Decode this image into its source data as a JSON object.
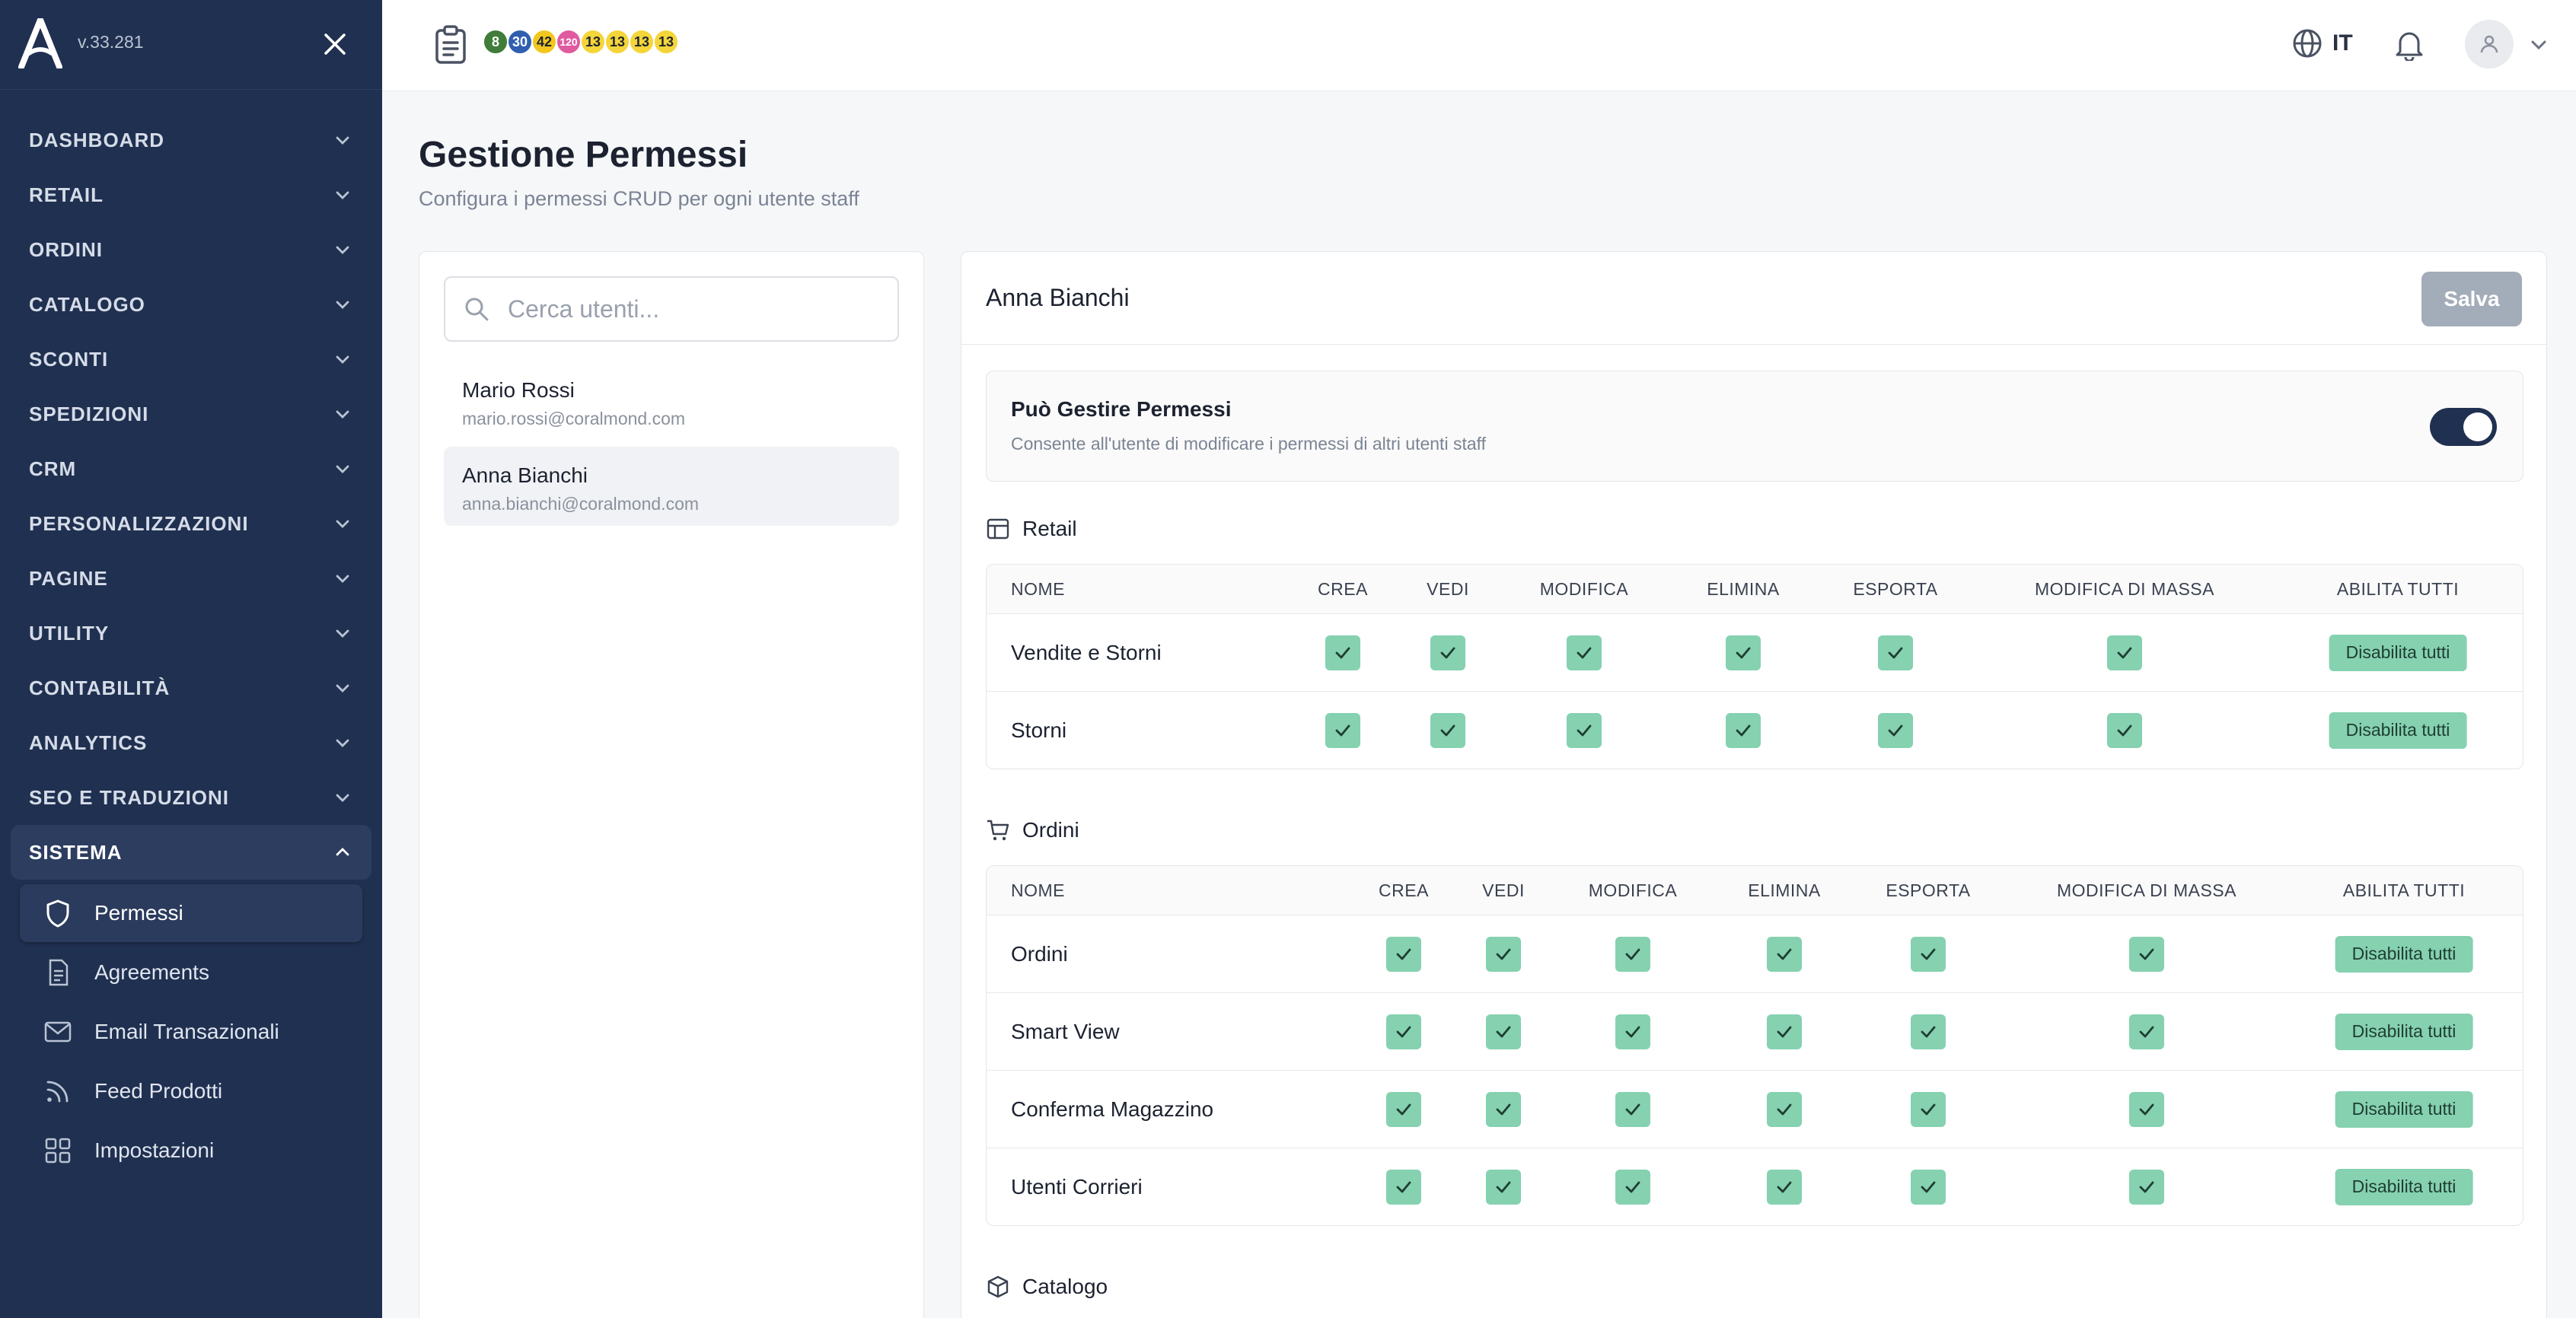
{
  "app": {
    "version": "v.33.281"
  },
  "sidebar": {
    "items": [
      {
        "label": "DASHBOARD"
      },
      {
        "label": "RETAIL"
      },
      {
        "label": "ORDINI"
      },
      {
        "label": "CATALOGO"
      },
      {
        "label": "SCONTI"
      },
      {
        "label": "SPEDIZIONI"
      },
      {
        "label": "CRM"
      },
      {
        "label": "PERSONALIZZAZIONI"
      },
      {
        "label": "PAGINE"
      },
      {
        "label": "UTILITY"
      },
      {
        "label": "CONTABILITÀ"
      },
      {
        "label": "ANALYTICS"
      },
      {
        "label": "SEO E TRADUZIONI"
      },
      {
        "label": "SISTEMA"
      }
    ],
    "active_index": 13,
    "subitems": [
      {
        "label": "Permessi",
        "icon": "shield-icon",
        "active": true
      },
      {
        "label": "Agreements",
        "icon": "document-icon",
        "active": false
      },
      {
        "label": "Email Transazionali",
        "icon": "mail-icon",
        "active": false
      },
      {
        "label": "Feed Prodotti",
        "icon": "rss-icon",
        "active": false
      },
      {
        "label": "Impostazioni",
        "icon": "grid-icon",
        "active": false
      }
    ]
  },
  "topbar": {
    "badges": [
      {
        "value": "8",
        "bg": "#3f7d3a",
        "fg": "#ffffff"
      },
      {
        "value": "30",
        "bg": "#2f5fae",
        "fg": "#ffffff"
      },
      {
        "value": "42",
        "bg": "#f1c71d",
        "fg": "#1f2430"
      },
      {
        "value": "120",
        "bg": "#e05aa0",
        "fg": "#ffffff"
      },
      {
        "value": "13",
        "bg": "#f4d53a",
        "fg": "#1f2430"
      },
      {
        "value": "13",
        "bg": "#f4d53a",
        "fg": "#1f2430"
      },
      {
        "value": "13",
        "bg": "#f4d53a",
        "fg": "#1f2430"
      },
      {
        "value": "13",
        "bg": "#f4d53a",
        "fg": "#1f2430"
      }
    ],
    "language": "IT"
  },
  "page": {
    "title": "Gestione Permessi",
    "subtitle": "Configura i permessi CRUD per ogni utente staff"
  },
  "users": {
    "search_placeholder": "Cerca utenti...",
    "list": [
      {
        "name": "Mario Rossi",
        "email": "mario.rossi@coralmond.com",
        "selected": false
      },
      {
        "name": "Anna Bianchi",
        "email": "anna.bianchi@coralmond.com",
        "selected": true
      }
    ]
  },
  "permissions": {
    "user_name": "Anna Bianchi",
    "save_label": "Salva",
    "manage": {
      "title": "Può Gestire Permessi",
      "description": "Consente all'utente di modificare i permessi di altri utenti staff",
      "enabled": true
    },
    "columns": [
      "NOME",
      "CREA",
      "VEDI",
      "MODIFICA",
      "ELIMINA",
      "ESPORTA",
      "MODIFICA DI MASSA",
      "ABILITA TUTTI"
    ],
    "disable_all_label": "Disabilita tutti",
    "sections": [
      {
        "title": "Retail",
        "icon": "table-icon",
        "rows": [
          {
            "name": "Vendite e Storni",
            "perms": [
              true,
              true,
              true,
              true,
              true,
              true
            ]
          },
          {
            "name": "Storni",
            "perms": [
              true,
              true,
              true,
              true,
              true,
              true
            ]
          }
        ]
      },
      {
        "title": "Ordini",
        "icon": "cart-icon",
        "rows": [
          {
            "name": "Ordini",
            "perms": [
              true,
              true,
              true,
              true,
              true,
              true
            ]
          },
          {
            "name": "Smart View",
            "perms": [
              true,
              true,
              true,
              true,
              true,
              true
            ]
          },
          {
            "name": "Conferma Magazzino",
            "perms": [
              true,
              true,
              true,
              true,
              true,
              true
            ]
          },
          {
            "name": "Utenti Corrieri",
            "perms": [
              true,
              true,
              true,
              true,
              true,
              true
            ]
          }
        ]
      },
      {
        "title": "Catalogo",
        "icon": "box-icon",
        "rows": []
      }
    ]
  }
}
